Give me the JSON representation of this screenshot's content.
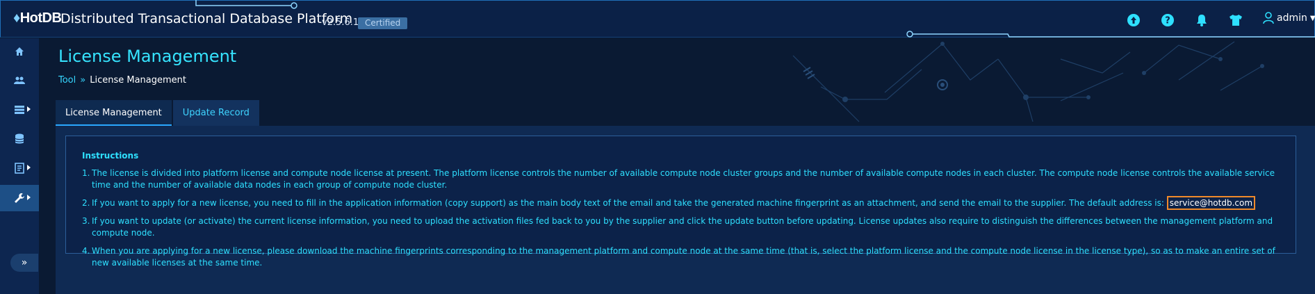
{
  "header": {
    "logo": "HotDB",
    "title": "Distributed Transactional Database Platform",
    "version": "v2.5.6.1",
    "badge": "Certified",
    "icons": [
      "upload-icon",
      "help-icon",
      "bell-icon",
      "tshirt-icon"
    ],
    "user": "admin"
  },
  "sidebar": {
    "items": [
      {
        "icon": "home-icon",
        "has_submenu": false
      },
      {
        "icon": "users-icon",
        "has_submenu": false
      },
      {
        "icon": "server-list-icon",
        "has_submenu": true
      },
      {
        "icon": "database-icon",
        "has_submenu": false
      },
      {
        "icon": "document-icon",
        "has_submenu": true
      },
      {
        "icon": "wrench-icon",
        "has_submenu": true,
        "active": true
      }
    ],
    "expand_label": "»"
  },
  "page": {
    "title": "License Management",
    "breadcrumb": {
      "link": "Tool",
      "separator": "»",
      "current": "License Management"
    }
  },
  "tabs": [
    {
      "label": "License Management",
      "active": true
    },
    {
      "label": "Update Record",
      "active": false
    }
  ],
  "instructions": {
    "title": "Instructions",
    "items": [
      {
        "num": "1.",
        "text": "The license is divided into platform license and compute node license at present. The platform license controls the number of available compute node cluster groups and the number of available compute nodes in each cluster. The compute node license controls the available service time and the number of available data nodes in each group of compute node cluster."
      },
      {
        "num": "2.",
        "text": "If you want to apply for a new license, you need to fill in the application information (copy support) as the main body text of the email and take the generated machine fingerprint as an attachment, and send the email to the supplier. The default address is:",
        "email": "service@hotdb.com"
      },
      {
        "num": "3.",
        "text": "If you want to update (or activate) the current license information, you need to upload the activation files fed back to you by the supplier and click the update button before updating. License updates also require to distinguish the differences between the management platform and compute node."
      },
      {
        "num": "4.",
        "text": "When you are applying for a new license, please download the machine fingerprints corresponding to the management platform and compute node at the same time (that is, select the platform license and the compute node license in the license type), so as to make an entire set of new available licenses at the same time."
      }
    ]
  },
  "colors": {
    "background": "#0a1a33",
    "accent": "#36e4ff",
    "highlight_border": "#f08a2a"
  }
}
